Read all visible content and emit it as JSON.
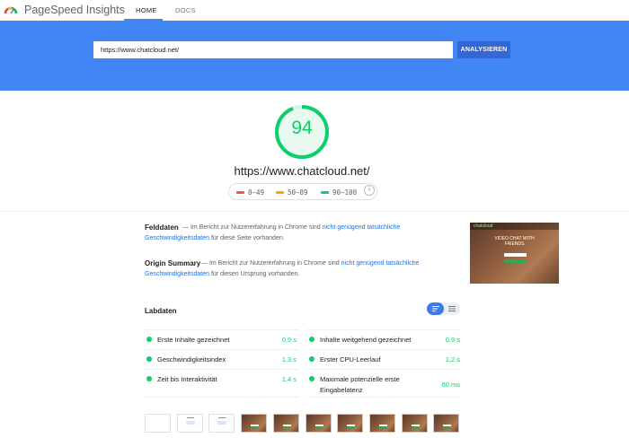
{
  "nav": {
    "brand": "PageSpeed Insights",
    "tabs": [
      {
        "label": "HOME",
        "active": true
      },
      {
        "label": "DOCS",
        "active": false
      }
    ]
  },
  "search": {
    "url_value": "https://www.chatcloud.net/",
    "button_label": "ANALYSIEREN"
  },
  "score": {
    "value": "94",
    "fraction": 0.94,
    "color": "#0cce6b",
    "url": "https://www.chatcloud.net/"
  },
  "legend": [
    {
      "range": "0–49",
      "color": "#ff4e42"
    },
    {
      "range": "50–89",
      "color": "#ffa400"
    },
    {
      "range": "90–100",
      "color": "#0cce6b"
    }
  ],
  "info_icon": "i",
  "field_data": {
    "title": "Felddaten",
    "text_before": "— Im Bericht zur Nutzererfahrung in Chrome sind",
    "link_part1": "nicht genügend tatsächliche",
    "link_part2": "Geschwindigkeitsdaten",
    "text_after": "für diese Seite vorhanden."
  },
  "origin_summary": {
    "title": "Origin Summary",
    "text_before": "— Im Bericht zur Nutzererfahrung in Chrome sind",
    "link_part1": "nicht genügend tatsächliche",
    "link_part2": "Geschwindigkeitsdaten",
    "text_after": "für diesen Ursprung vorhanden."
  },
  "screenshot": {
    "logo_text": "chatcloud",
    "headline_1": "VIDEO CHAT WITH",
    "headline_2": "FRIENDS"
  },
  "lab_data": {
    "title": "Labdaten",
    "metrics": [
      {
        "label": "Erste Inhalte gezeichnet",
        "value": "0,9 s",
        "status": "good"
      },
      {
        "label": "Inhalte weitgehend gezeichnet",
        "value": "0,9 s",
        "status": "good"
      },
      {
        "label": "Geschwindigkeitsindex",
        "value": "1,3 s",
        "status": "good"
      },
      {
        "label": "Erster CPU-Leerlauf",
        "value": "1,2 s",
        "status": "good"
      },
      {
        "label": "Zeit bis Interaktivität",
        "value": "1,4 s",
        "status": "good"
      },
      {
        "label": "Maximale potenzielle erste",
        "label_line2": "Eingabelatenz",
        "value": "60 ms",
        "status": "good"
      }
    ]
  },
  "filmstrip": [
    "blank",
    "partial",
    "partial",
    "full",
    "full",
    "full",
    "full",
    "full",
    "full",
    "full"
  ]
}
